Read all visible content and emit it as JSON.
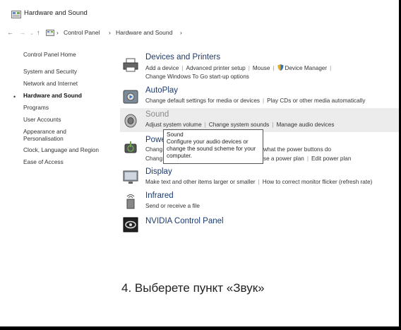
{
  "window": {
    "title": "Hardware and Sound"
  },
  "address": {
    "path": [
      "Control Panel",
      "Hardware and Sound"
    ]
  },
  "sidebar": {
    "items": [
      "Control Panel Home",
      "System and Security",
      "Network and Internet",
      "Hardware and Sound",
      "Programs",
      "User Accounts",
      "Appearance and",
      "Personalisation",
      "Clock, Language and Region",
      "Ease of Access"
    ]
  },
  "categories": [
    {
      "title": "Devices and Printers",
      "links": [
        "Add a device",
        "Advanced printer setup",
        "Mouse",
        "Device Manager",
        "Change Windows To Go start-up options"
      ]
    },
    {
      "title": "AutoPlay",
      "links": [
        "Change default settings for media or devices",
        "Play CDs or other media automatically"
      ]
    },
    {
      "title": "Sound",
      "links": [
        "Adjust system volume",
        "Change system sounds",
        "Manage audio devices"
      ]
    },
    {
      "title": "Powe",
      "links": [
        "Chang",
        "what the power buttons do",
        "Chang",
        "se a power plan",
        "Edit power plan"
      ]
    },
    {
      "title": "Display",
      "links": [
        "Make text and other items larger or smaller",
        "How to correct monitor flicker (refresh rate)"
      ]
    },
    {
      "title": "Infrared",
      "links": [
        "Send or receive a file"
      ]
    },
    {
      "title": "NVIDIA Control Panel",
      "links": []
    }
  ],
  "tooltip": {
    "title": "Sound",
    "lines": [
      "Configure your audio devices or",
      "change the sound scheme for your",
      "computer."
    ]
  },
  "caption": "4. Выберете пункт «Звук»",
  "icons": {
    "title": "control-panel-icon",
    "back": "back-arrow-icon",
    "forward": "forward-arrow-icon",
    "up": "up-arrow-icon",
    "shield": "shield-icon"
  },
  "colors": {
    "link_title": "#1d3a6e",
    "highlight": "#ececec"
  }
}
